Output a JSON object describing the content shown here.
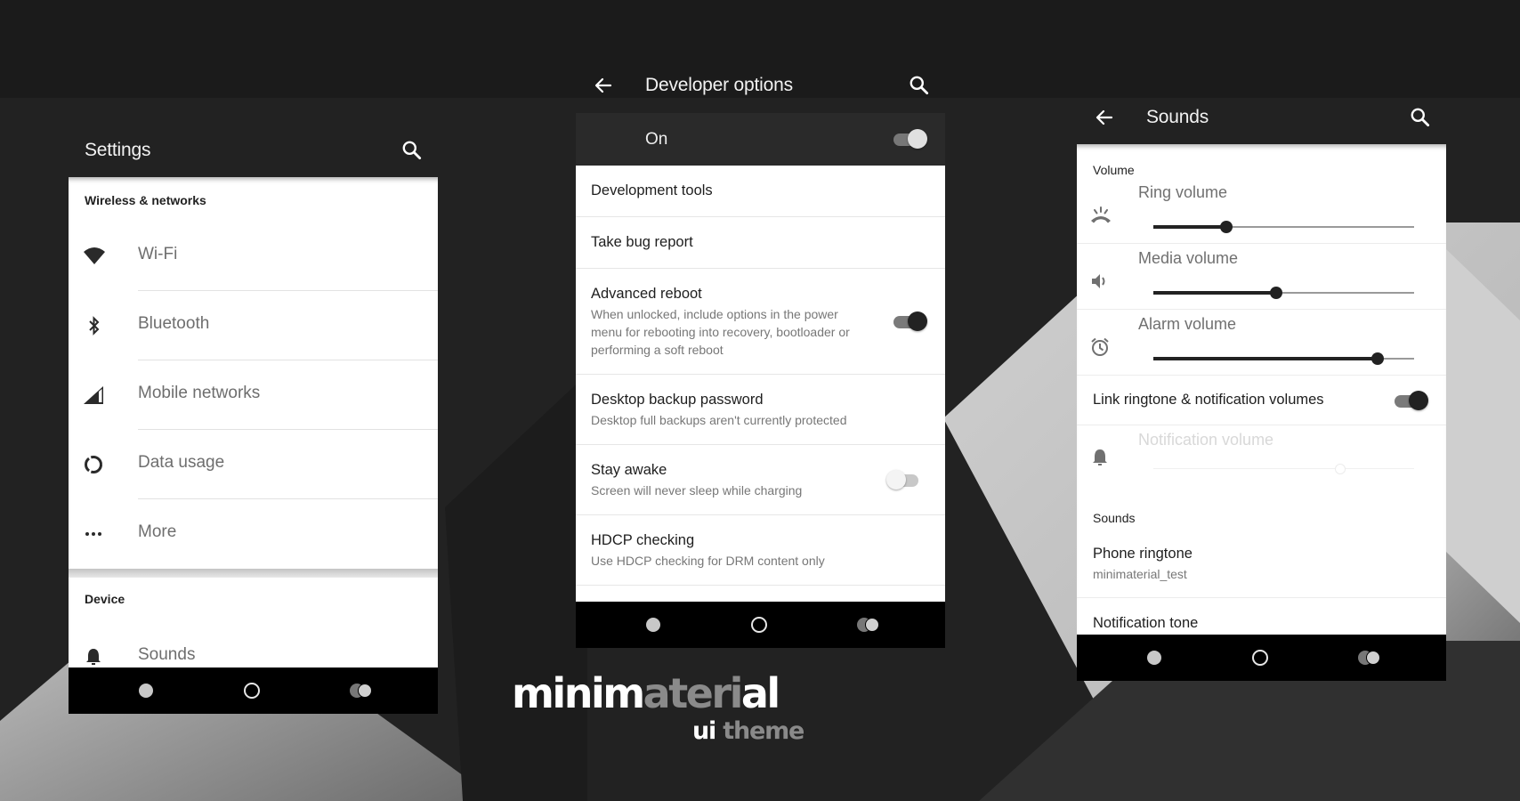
{
  "colors": {
    "background": "#222222",
    "appbar": "#1b1b1b",
    "accent_dark": "#222222",
    "switch_track_on": "#777777",
    "text_primary": "#1e1e1e",
    "text_secondary": "#777777"
  },
  "settings_screen": {
    "title": "Settings",
    "search_icon": "search-icon",
    "sections": [
      {
        "header": "Wireless & networks",
        "items": [
          {
            "label": "Wi-Fi",
            "icon": "wifi-icon"
          },
          {
            "label": "Bluetooth",
            "icon": "bluetooth-icon"
          },
          {
            "label": "Mobile networks",
            "icon": "signal-icon"
          },
          {
            "label": "Data usage",
            "icon": "data-usage-icon"
          },
          {
            "label": "More",
            "icon": "more-icon"
          }
        ]
      },
      {
        "header": "Device",
        "items": [
          {
            "label": "Sounds",
            "icon": "bell-icon"
          }
        ]
      }
    ]
  },
  "developer_screen": {
    "title": "Developer options",
    "master_switch": {
      "label": "On",
      "checked": true
    },
    "items": [
      {
        "title": "Development tools"
      },
      {
        "title": "Take bug report"
      },
      {
        "title": "Advanced reboot",
        "summary": "When unlocked, include options in the power menu for rebooting into recovery, bootloader or performing a soft reboot",
        "switch": true
      },
      {
        "title": "Desktop backup password",
        "summary": "Desktop full backups aren't currently protected"
      },
      {
        "title": "Stay awake",
        "summary": "Screen will never sleep while charging",
        "switch": false
      },
      {
        "title": "HDCP checking",
        "summary": "Use HDCP checking for DRM content only"
      }
    ]
  },
  "sounds_screen": {
    "title": "Sounds",
    "volume_header": "Volume",
    "volumes": [
      {
        "label": "Ring volume",
        "icon": "ring-volume-icon",
        "level": 0.28,
        "enabled": true
      },
      {
        "label": "Media volume",
        "icon": "speaker-icon",
        "level": 0.47,
        "enabled": true
      },
      {
        "label": "Alarm volume",
        "icon": "alarm-icon",
        "level": 0.86,
        "enabled": true
      }
    ],
    "link_toggle": {
      "label": "Link ringtone & notification volumes",
      "checked": true
    },
    "notification_volume": {
      "label": "Notification volume",
      "icon": "bell-icon",
      "level": 0.72,
      "enabled": false
    },
    "sounds_header": "Sounds",
    "phone_ringtone": {
      "title": "Phone ringtone",
      "summary": "minimaterial_test"
    },
    "notification_tone": {
      "title": "Notification tone"
    }
  },
  "navbar": {
    "back": "back-dot-icon",
    "home": "home-circle-icon",
    "recents": "recents-icon"
  },
  "branding": {
    "name_part1": "minim",
    "name_part2": "ateri",
    "name_part3": "al",
    "subtitle_part1": "ui",
    "subtitle_part2": " theme"
  }
}
